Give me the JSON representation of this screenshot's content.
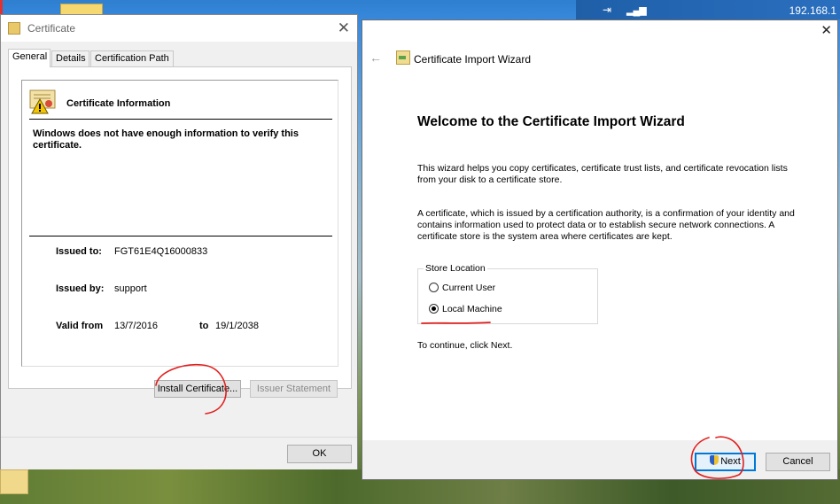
{
  "status_bar": {
    "net_icon": "network-icon",
    "signal_icon": "signal-bars-icon",
    "ip_text": "192.168.1"
  },
  "certificate_dialog": {
    "title": "Certificate",
    "close_glyph": "✕",
    "tabs": [
      {
        "label": "General",
        "active": true
      },
      {
        "label": "Details",
        "active": false
      },
      {
        "label": "Certification Path",
        "active": false
      }
    ],
    "info_heading": "Certificate Information",
    "warning": "Windows does not have enough information to verify this certificate.",
    "issued_to_label": "Issued to:",
    "issued_to_value": "FGT61E4Q16000833",
    "issued_by_label": "Issued by:",
    "issued_by_value": "support",
    "valid_from_label": "Valid from",
    "valid_from_value": "13/7/2016",
    "valid_to_label": "to",
    "valid_to_value": "19/1/2038",
    "install_button": "Install Certificate...",
    "issuer_button": "Issuer Statement",
    "ok_button": "OK"
  },
  "import_wizard": {
    "close_glyph": "✕",
    "back_glyph": "←",
    "title": "Certificate Import Wizard",
    "heading": "Welcome to the Certificate Import Wizard",
    "paragraph1": "This wizard helps you copy certificates, certificate trust lists, and certificate revocation lists from your disk to a certificate store.",
    "paragraph2": "A certificate, which is issued by a certification authority, is a confirmation of your identity and contains information used to protect data or to establish secure network connections. A certificate store is the system area where certificates are kept.",
    "store_location_label": "Store Location",
    "options": [
      {
        "label": "Current User",
        "checked": false
      },
      {
        "label": "Local Machine",
        "checked": true
      }
    ],
    "continue_text": "To continue, click Next.",
    "next_button": "Next",
    "cancel_button": "Cancel"
  },
  "colors": {
    "annotation_red": "#e0201e",
    "focus_blue": "#0078d7"
  }
}
